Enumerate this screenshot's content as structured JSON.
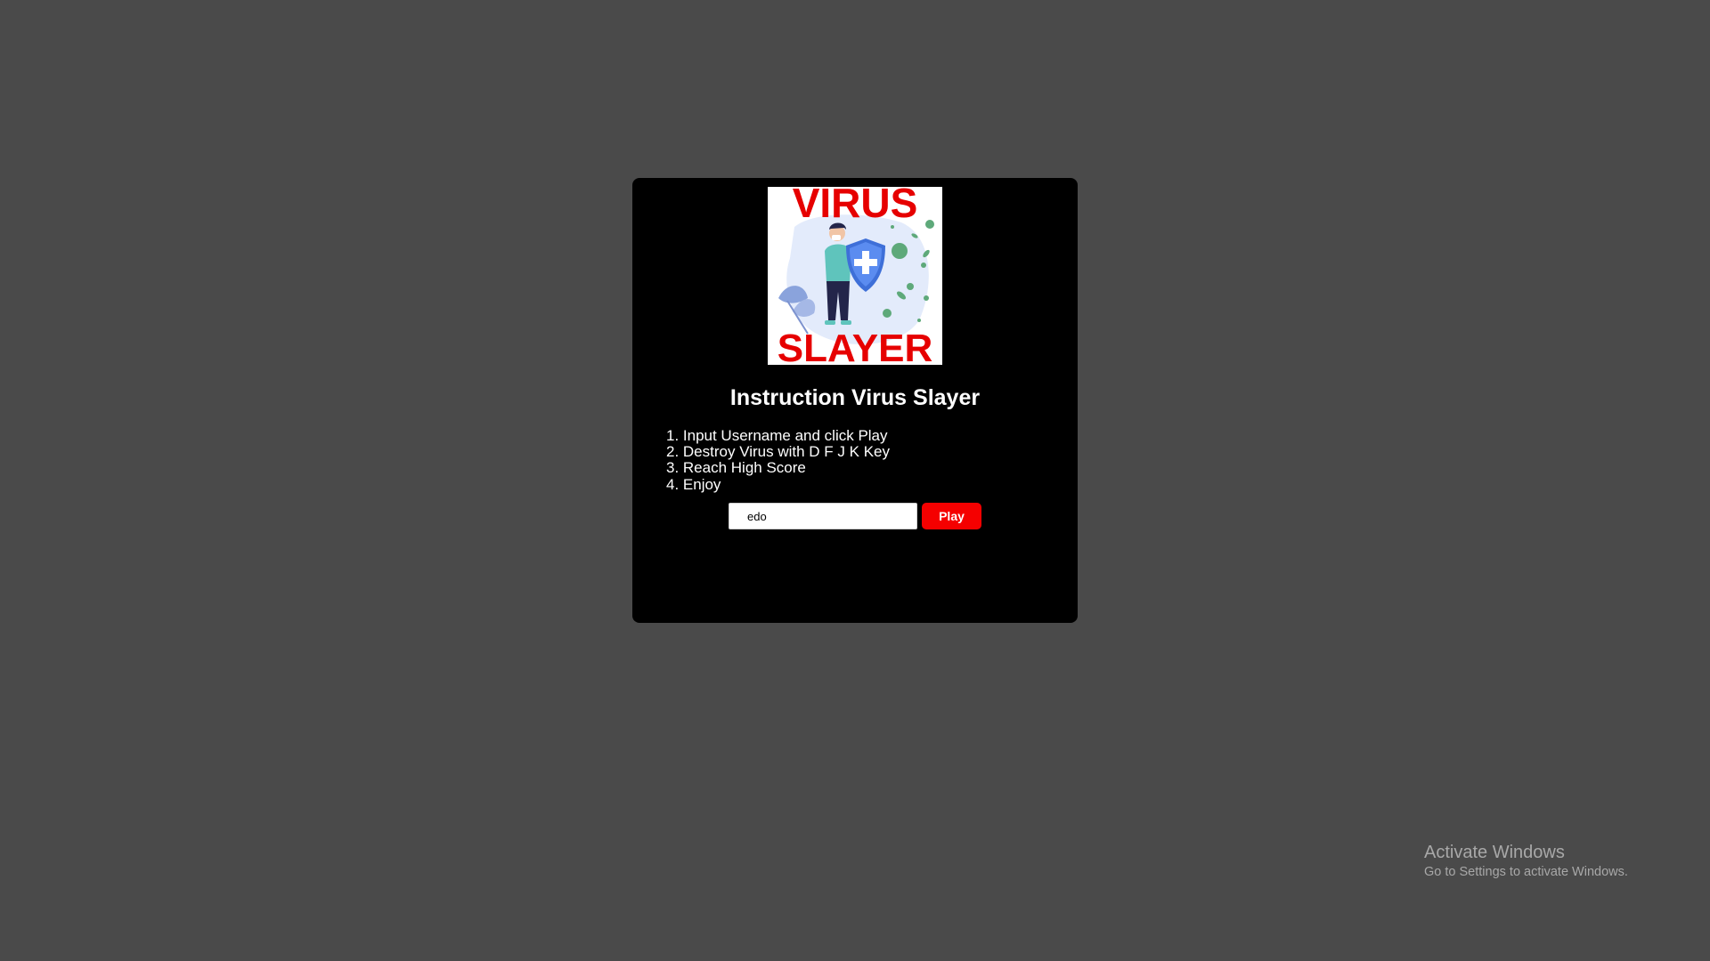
{
  "game": {
    "logo": {
      "top_text": "VIRUS",
      "bottom_text": "SLAYER",
      "text_color": "#e60000",
      "icon": "doctor-shield-virus-illustration"
    },
    "title": "Instruction Virus Slayer",
    "instructions": [
      "1. Input Username and click Play",
      "2. Destroy Virus with D F J K Key",
      "3. Reach High Score",
      "4. Enjoy"
    ],
    "username_value": "edo",
    "play_label": "Play",
    "play_color": "#f50000"
  },
  "colors": {
    "background": "#4a4a4a",
    "panel": "#000000"
  },
  "watermark": {
    "title": "Activate Windows",
    "subtitle": "Go to Settings to activate Windows."
  }
}
